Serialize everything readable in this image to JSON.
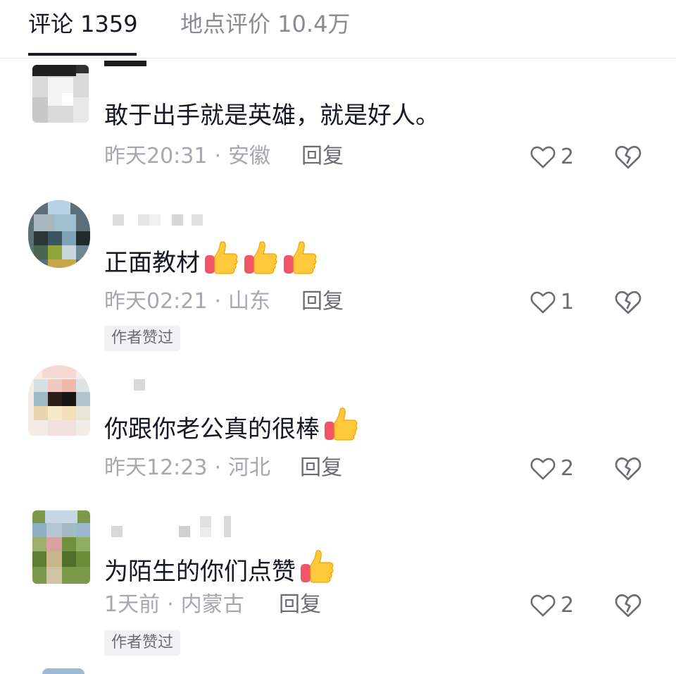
{
  "tabs": {
    "comments_label": "评论 1359",
    "place_reviews_label": "地点评价 10.4万"
  },
  "comments": [
    {
      "text": "敢于出手就是英雄，就是好人。",
      "time": "昨天20:31",
      "location": "安徽",
      "reply_label": "回复",
      "likes": "2"
    },
    {
      "text": "正面教材",
      "emojis": [
        "thumbs-up",
        "thumbs-up",
        "thumbs-up"
      ],
      "time": "昨天02:21",
      "location": "山东",
      "reply_label": "回复",
      "likes": "1",
      "badge": "作者赞过"
    },
    {
      "text": "你跟你老公真的很棒",
      "emojis": [
        "thumbs-up"
      ],
      "time": "昨天12:23",
      "location": "河北",
      "reply_label": "回复",
      "likes": "2"
    },
    {
      "text": "为陌生的你们点赞",
      "emojis": [
        "thumbs-up"
      ],
      "time": "1天前",
      "location": "内蒙古",
      "reply_label": "回复",
      "likes": "2",
      "badge": "作者赞过"
    }
  ],
  "icons": {
    "like": "heart-outline-icon",
    "dislike": "broken-heart-icon",
    "emoji": "thumbs-up-emoji"
  },
  "colors": {
    "primary_text": "#161823",
    "secondary_text": "#a7a8ad",
    "badge_bg": "#f2f2f4"
  }
}
